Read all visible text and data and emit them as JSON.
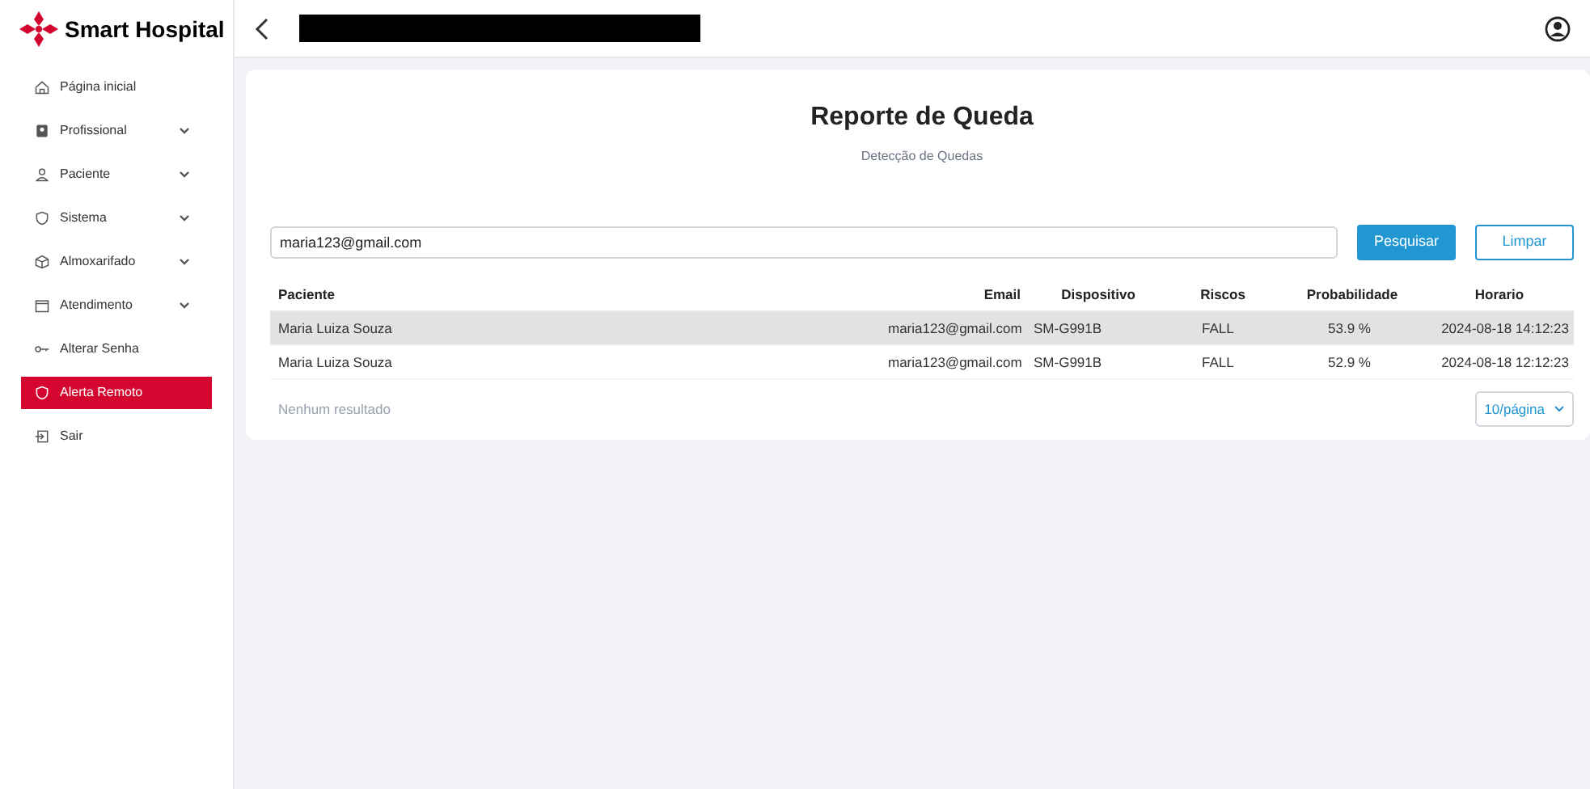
{
  "brand": {
    "name": "Smart Hospital"
  },
  "sidebar": {
    "items": [
      {
        "label": "Página inicial",
        "kind": "home",
        "expandable": false,
        "selected": false
      },
      {
        "label": "Profissional",
        "kind": "badge",
        "expandable": true,
        "selected": false
      },
      {
        "label": "Paciente",
        "kind": "user",
        "expandable": true,
        "selected": false
      },
      {
        "label": "Sistema",
        "kind": "shield",
        "expandable": true,
        "selected": false
      },
      {
        "label": "Almoxarifado",
        "kind": "box",
        "expandable": true,
        "selected": false
      },
      {
        "label": "Atendimento",
        "kind": "calendar",
        "expandable": true,
        "selected": false
      },
      {
        "label": "Alterar Senha",
        "kind": "key",
        "expandable": false,
        "selected": false
      },
      {
        "label": "Alerta Remoto",
        "kind": "shield",
        "expandable": false,
        "selected": true
      },
      {
        "label": "Sair",
        "kind": "logout",
        "expandable": false,
        "selected": false
      }
    ]
  },
  "page": {
    "title": "Reporte de Queda",
    "subtitle": "Detecção de Quedas"
  },
  "search": {
    "value": "maria123@gmail.com",
    "buttons": [
      "Pesquisar",
      "Limpar"
    ]
  },
  "table": {
    "columns": [
      "Paciente",
      "Email",
      "Dispositivo",
      "Riscos",
      "Probabilidade",
      "Horario"
    ],
    "rows": [
      {
        "cells": [
          "Maria Luiza Souza",
          "maria123@gmail.com",
          "SM-G991B",
          "FALL",
          "53.9 %",
          "2024-08-18 14:12:23"
        ],
        "highlighted": true
      },
      {
        "cells": [
          "Maria Luiza Souza",
          "maria123@gmail.com",
          "SM-G991B",
          "FALL",
          "52.9 %",
          "2024-08-18 12:12:23"
        ],
        "highlighted": false
      }
    ]
  },
  "footer": {
    "empty_text": "Nenhum resultado",
    "page_size": "10/página"
  }
}
